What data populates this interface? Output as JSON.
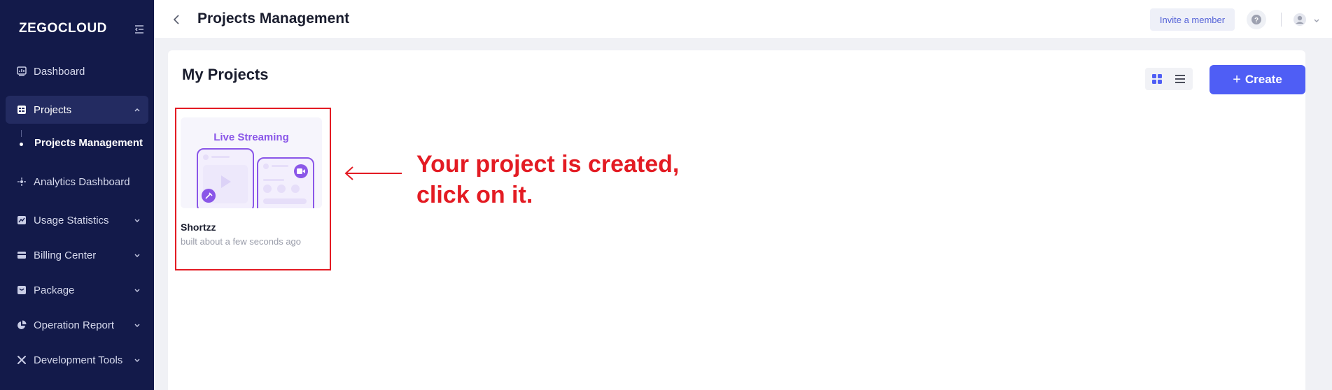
{
  "sidebar": {
    "brand": "ZEGOCLOUD",
    "items": [
      {
        "label": "Dashboard",
        "icon": "dashboard-icon"
      },
      {
        "label": "Projects",
        "icon": "projects-icon",
        "expanded": true
      },
      {
        "label": "Analytics Dashboard",
        "icon": "analytics-icon"
      },
      {
        "label": "Usage Statistics",
        "icon": "chart-icon"
      },
      {
        "label": "Billing Center",
        "icon": "card-icon"
      },
      {
        "label": "Package",
        "icon": "package-icon"
      },
      {
        "label": "Operation Report",
        "icon": "pie-icon"
      },
      {
        "label": "Development Tools",
        "icon": "tools-icon"
      }
    ],
    "sub_item": "Projects Management"
  },
  "header": {
    "title": "Projects Management",
    "invite_label": "Invite a member"
  },
  "main": {
    "section_title": "My Projects",
    "create_label": "Create",
    "projects": [
      {
        "thumbnail_label": "Live Streaming",
        "name": "Shortzz",
        "built": "built about a few seconds ago"
      }
    ]
  },
  "annotation": {
    "line1": "Your project is created,",
    "line2": "click on it.",
    "color": "#e31b23"
  },
  "colors": {
    "sidebar_bg": "#131a4a",
    "accent": "#4f5ef5",
    "thumbnail_accent": "#8a56e8"
  }
}
